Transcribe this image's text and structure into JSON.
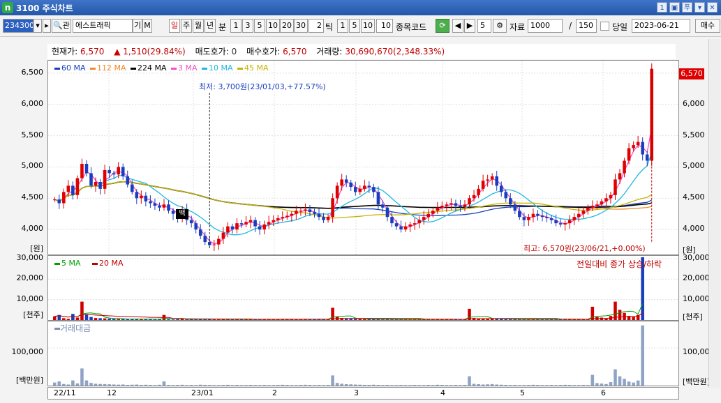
{
  "window": {
    "title": "3100 주식차트",
    "logo": "n",
    "buttons": [
      "1",
      "▣",
      "푸",
      "▾",
      "✕"
    ]
  },
  "toolbar": {
    "code": "234300",
    "name": "에스트래픽",
    "code_btn1": "▾",
    "code_btn2": "▸",
    "search_btn": "🔍관",
    "gi_btn": "기",
    "m_btn": "M",
    "period_tabs": [
      "일",
      "주",
      "월",
      "년"
    ],
    "bun_label": "분",
    "minute_opts": [
      "1",
      "3",
      "5",
      "10",
      "20",
      "30"
    ],
    "tick_value": "2",
    "tick_label": "틱",
    "tick_opts": [
      "1",
      "5",
      "10"
    ],
    "tick_field": "10",
    "stock_code_label": "종목코드",
    "step_value": "5",
    "data_label": "자료",
    "data_count": "1000",
    "slash": "/",
    "page_size": "150",
    "today_label": "당일",
    "date": "2023-06-21",
    "buy_btn": "매수"
  },
  "info": {
    "current_label": "현재가:",
    "current_value": "6,570",
    "change_value": "1,510(29.84%)",
    "ask_label": "매도호가:",
    "ask_value": "0",
    "bid_label": "매수호가:",
    "bid_value": "6,570",
    "volume_label": "거래량:",
    "volume_value": "30,690,670(2,348.33%)"
  },
  "price_panel": {
    "legend": [
      {
        "label": "60 MA",
        "color": "#1a3dbf"
      },
      {
        "label": "112 MA",
        "color": "#f08a24"
      },
      {
        "label": "224 MA",
        "color": "#000000"
      },
      {
        "label": "3 MA",
        "color": "#f050c8"
      },
      {
        "label": "10 MA",
        "color": "#20b8e0"
      },
      {
        "label": "45 MA",
        "color": "#c8b400"
      }
    ],
    "y_ticks": [
      "6,500",
      "6,000",
      "5,500",
      "5,000",
      "4,500",
      "4,000"
    ],
    "unit": "[원]",
    "last_price_tag": "6,570",
    "low_annotation": "최저: 3,700원(23/01/03,+77.57%)",
    "high_annotation": "최고: 6,570원(23/06/21,+0.00%)",
    "baek_marker": "백"
  },
  "volume_panel": {
    "legend": [
      {
        "label": "5 MA",
        "color": "#00a000"
      },
      {
        "label": "20 MA",
        "color": "#c00000"
      }
    ],
    "y_ticks": [
      "30,000",
      "20,000",
      "10,000"
    ],
    "unit": "[천주]",
    "note": "전일대비 종가 상승/하락"
  },
  "amount_panel": {
    "legend": "거래대금",
    "y_ticks": [
      "100,000"
    ],
    "unit": "[백만원]"
  },
  "x_axis": [
    "22/11",
    "12",
    "23/01",
    "2",
    "3",
    "4",
    "5",
    "6"
  ],
  "chart_data": {
    "type": "candlestick",
    "title": "",
    "ylabel": "원",
    "ylim": [
      3600,
      6700
    ],
    "x_labels": [
      "22/11",
      "12",
      "23/01",
      "2",
      "3",
      "4",
      "5",
      "6"
    ],
    "price_min": {
      "value": 3700,
      "date": "23/01/03"
    },
    "price_max": {
      "value": 6570,
      "date": "23/06/21"
    },
    "close_series": [
      4480,
      4420,
      4600,
      4700,
      4550,
      4820,
      5050,
      4900,
      4700,
      4760,
      4650,
      4950,
      4900,
      4880,
      5000,
      4850,
      4720,
      4600,
      4500,
      4540,
      4450,
      4420,
      4380,
      4350,
      4400,
      4300,
      4250,
      4200,
      4320,
      4150,
      4100,
      4000,
      3900,
      3800,
      3750,
      3760,
      3850,
      3950,
      4050,
      4000,
      4100,
      4080,
      4120,
      4150,
      4050,
      4000,
      4080,
      4120,
      4150,
      4180,
      4200,
      4220,
      4250,
      4300,
      4300,
      4320,
      4280,
      4250,
      4200,
      4150,
      4200,
      4500,
      4700,
      4800,
      4750,
      4680,
      4600,
      4650,
      4700,
      4680,
      4600,
      4400,
      4350,
      4200,
      4100,
      4050,
      4000,
      4050,
      4080,
      4100,
      4150,
      4200,
      4250,
      4300,
      4350,
      4380,
      4400,
      4420,
      4380,
      4360,
      4400,
      4500,
      4550,
      4650,
      4780,
      4800,
      4850,
      4700,
      4600,
      4500,
      4400,
      4300,
      4200,
      4150,
      4200,
      4250,
      4220,
      4200,
      4180,
      4150,
      4100,
      4080,
      4100,
      4150,
      4200,
      4250,
      4300,
      4350,
      4380,
      4400,
      4450,
      4500,
      4550,
      4800,
      4900,
      5100,
      5300,
      5350,
      5400,
      5200,
      5100,
      6570
    ],
    "volume_series_thousand": [
      1800,
      2500,
      900,
      600,
      3000,
      1200,
      9000,
      2800,
      1500,
      1000,
      900,
      800,
      700,
      600,
      500,
      600,
      400,
      500,
      600,
      400,
      500,
      400,
      300,
      500,
      2500,
      400,
      300,
      400,
      500,
      300,
      400,
      300,
      600,
      500,
      400,
      300,
      300,
      400,
      500,
      300,
      400,
      300,
      300,
      400,
      300,
      300,
      400,
      300,
      300,
      400,
      500,
      400,
      300,
      300,
      400,
      500,
      400,
      300,
      400,
      300,
      400,
      6000,
      1500,
      1000,
      800,
      700,
      600,
      500,
      400,
      400,
      500,
      400,
      300,
      400,
      300,
      300,
      400,
      300,
      300,
      400,
      300,
      300,
      400,
      300,
      500,
      400,
      300,
      300,
      400,
      300,
      400,
      5500,
      1000,
      800,
      600,
      700,
      800,
      600,
      500,
      400,
      300,
      400,
      300,
      300,
      400,
      500,
      400,
      300,
      300,
      400,
      300,
      400,
      500,
      400,
      300,
      300,
      400,
      300,
      6500,
      1500,
      1200,
      900,
      2000,
      9000,
      5000,
      3500,
      2000,
      1500,
      2500,
      30690
    ]
  }
}
